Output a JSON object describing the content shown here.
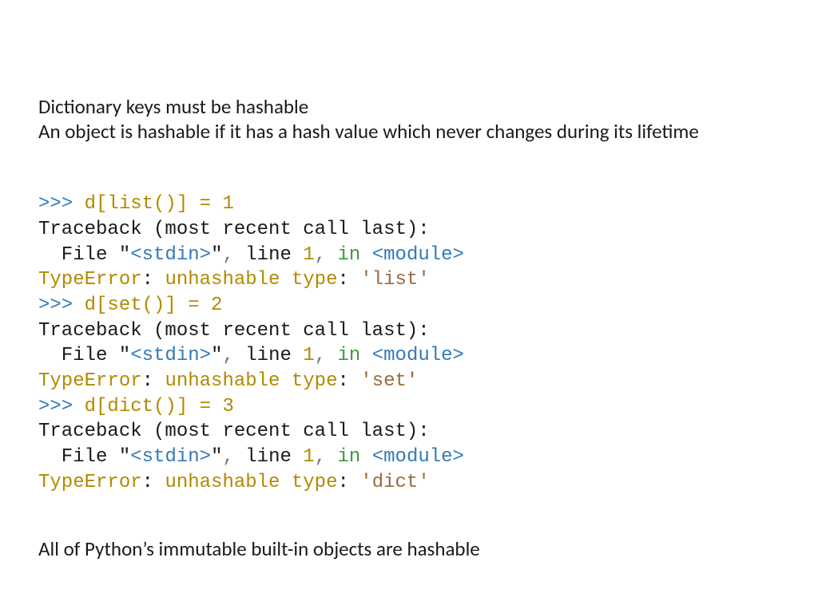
{
  "heading": {
    "l1": "Dictionary keys must be hashable",
    "l2": "An object is hashable if it has a hash value which never changes during its lifetime"
  },
  "code": {
    "prompt": ">>> ",
    "l1a": "d[list()] = ",
    "l1b": "1",
    "tb": "Traceback (most recent call last):",
    "fl1": "  File ",
    "fl_q1": "\"",
    "fl_stdin": "<stdin>",
    "fl_q2": "\"",
    "fl_comma1": ", ",
    "fl_line": "line ",
    "fl_num": "1",
    "fl_comma2": ", ",
    "fl_in": "in ",
    "fl_mod": "<module>",
    "te": "TypeError",
    "te_colon": ": ",
    "te_msg": "unhashable type",
    "te_colon2": ": ",
    "te_q1": "'",
    "te_list": "list",
    "te_q2": "'",
    "l2a": "d[set()] = ",
    "l2b": "2",
    "te_set": "set",
    "l3a": "d[dict()] = ",
    "l3b": "3",
    "te_dict": "dict"
  },
  "footer": "All of Python’s immutable built-in objects are hashable"
}
